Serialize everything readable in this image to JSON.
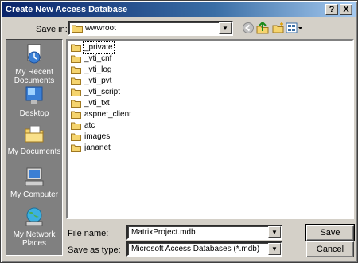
{
  "title": "Create New Access Database",
  "titlebar_buttons": {
    "help": "?",
    "close": "X"
  },
  "save_in": {
    "label": "Save in:",
    "value": "wwwroot"
  },
  "toolbar_icons": [
    "back-icon",
    "up-folder-icon",
    "new-folder-icon",
    "views-menu-icon"
  ],
  "places": [
    {
      "name": "recent",
      "label": "My Recent Documents",
      "icon": "recent-documents-icon"
    },
    {
      "name": "desktop",
      "label": "Desktop",
      "icon": "desktop-icon"
    },
    {
      "name": "documents",
      "label": "My Documents",
      "icon": "my-documents-icon"
    },
    {
      "name": "computer",
      "label": "My Computer",
      "icon": "my-computer-icon"
    },
    {
      "name": "network",
      "label": "My Network Places",
      "icon": "network-places-icon"
    }
  ],
  "files": [
    {
      "name": "_private",
      "selected": true
    },
    {
      "name": "_vti_cnf",
      "selected": false
    },
    {
      "name": "_vti_log",
      "selected": false
    },
    {
      "name": "_vti_pvt",
      "selected": false
    },
    {
      "name": "_vti_script",
      "selected": false
    },
    {
      "name": "_vti_txt",
      "selected": false
    },
    {
      "name": "aspnet_client",
      "selected": false
    },
    {
      "name": "atc",
      "selected": false
    },
    {
      "name": "images",
      "selected": false
    },
    {
      "name": "jananet",
      "selected": false
    }
  ],
  "file_name": {
    "label": "File name:",
    "value": "MatrixProject.mdb"
  },
  "save_as_type": {
    "label": "Save as type:",
    "value": "Microsoft Access Databases (*.mdb)"
  },
  "buttons": {
    "save": "Save",
    "cancel": "Cancel"
  },
  "colors": {
    "title_start": "#0a246a",
    "title_end": "#a6caf0",
    "places_bg": "#808080",
    "folder": "#f5d46e"
  }
}
